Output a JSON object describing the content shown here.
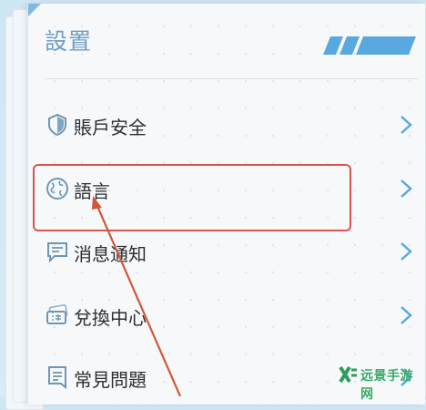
{
  "header": {
    "title": "設置"
  },
  "menu": {
    "items": [
      {
        "label": "賬戶安全",
        "icon": "shield-icon"
      },
      {
        "label": "語言",
        "icon": "globe-icon"
      },
      {
        "label": "消息通知",
        "icon": "message-icon"
      },
      {
        "label": "兌換中心",
        "icon": "ticket-icon"
      },
      {
        "label": "常見問題",
        "icon": "document-icon"
      }
    ]
  },
  "watermark": {
    "text": "远景手游网"
  },
  "colors": {
    "accent": "#5aa8e0",
    "highlight": "#d9534f",
    "title": "#6f9fc4"
  }
}
